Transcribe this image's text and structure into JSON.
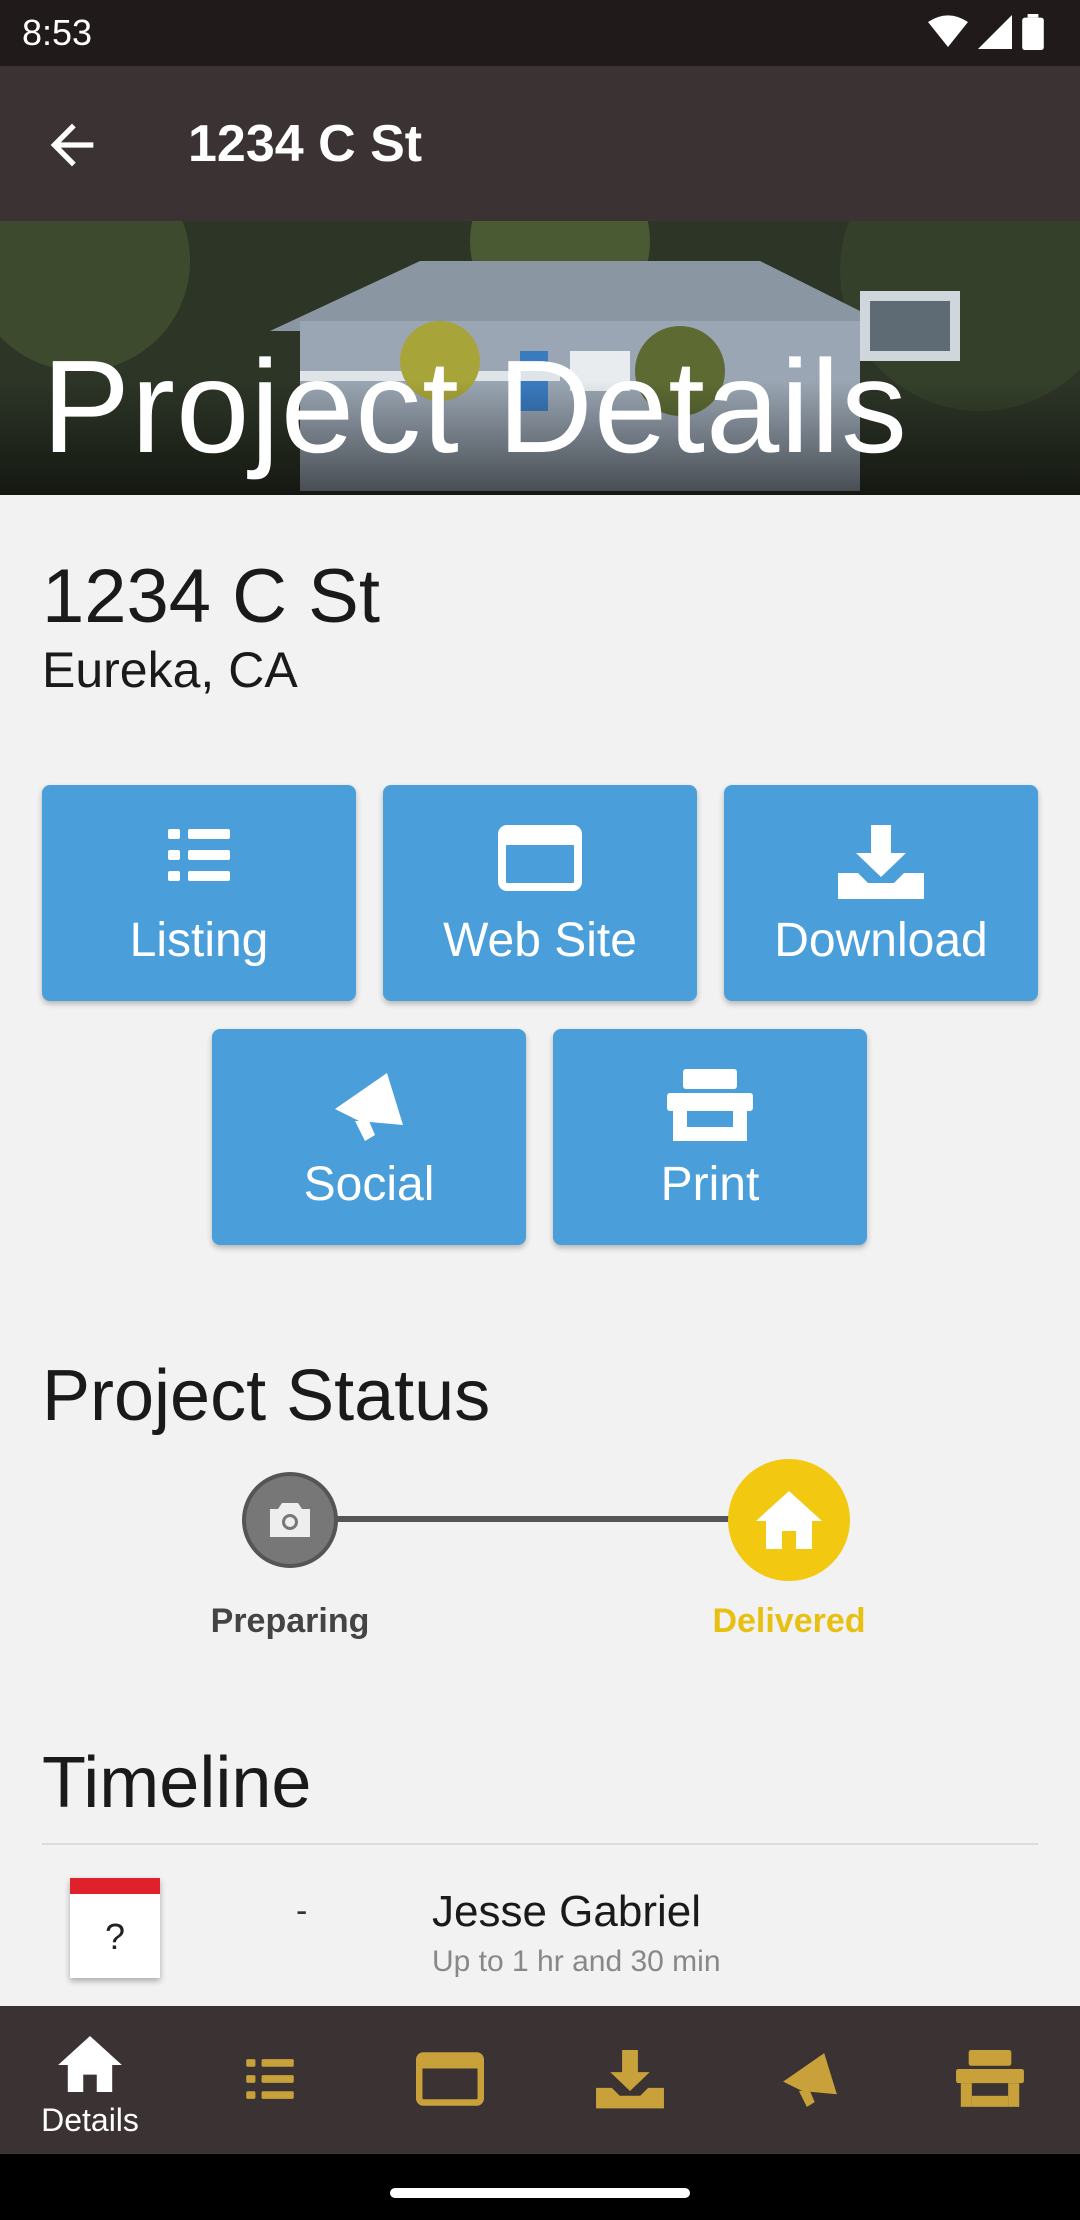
{
  "status_bar": {
    "time": "8:53"
  },
  "app_bar": {
    "title": "1234 C St"
  },
  "hero": {
    "title": "Project Details"
  },
  "property": {
    "address": "1234 C St",
    "city": "Eureka, CA"
  },
  "actions": [
    {
      "label": "Listing",
      "icon": "list-icon"
    },
    {
      "label": "Web Site",
      "icon": "browser-window-icon"
    },
    {
      "label": "Download",
      "icon": "download-icon"
    },
    {
      "label": "Social",
      "icon": "megaphone-icon"
    },
    {
      "label": "Print",
      "icon": "printer-icon"
    }
  ],
  "project_status": {
    "title": "Project Status",
    "steps": [
      {
        "label": "Preparing",
        "icon": "camera-icon",
        "color": "#6a6a6a",
        "label_color": "#444444"
      },
      {
        "label": "Delivered",
        "icon": "home-icon",
        "color": "#f2c811",
        "label_color": "#e7c012"
      }
    ]
  },
  "timeline": {
    "title": "Timeline",
    "items": [
      {
        "date": "?",
        "dash": "-",
        "name": "Jesse Gabriel",
        "detail": "Up to 1 hr and 30 min"
      }
    ]
  },
  "bottom_nav": [
    {
      "label": "Details",
      "icon": "home-icon",
      "active": true
    },
    {
      "label": "",
      "icon": "list-icon"
    },
    {
      "label": "",
      "icon": "browser-window-icon"
    },
    {
      "label": "",
      "icon": "download-icon"
    },
    {
      "label": "",
      "icon": "megaphone-icon"
    },
    {
      "label": "",
      "icon": "printer-icon"
    }
  ],
  "colors": {
    "accent": "#4a9fdb",
    "nav_icon": "#c9a13a",
    "app_bar": "#3b3233",
    "delivered": "#f2c811"
  }
}
